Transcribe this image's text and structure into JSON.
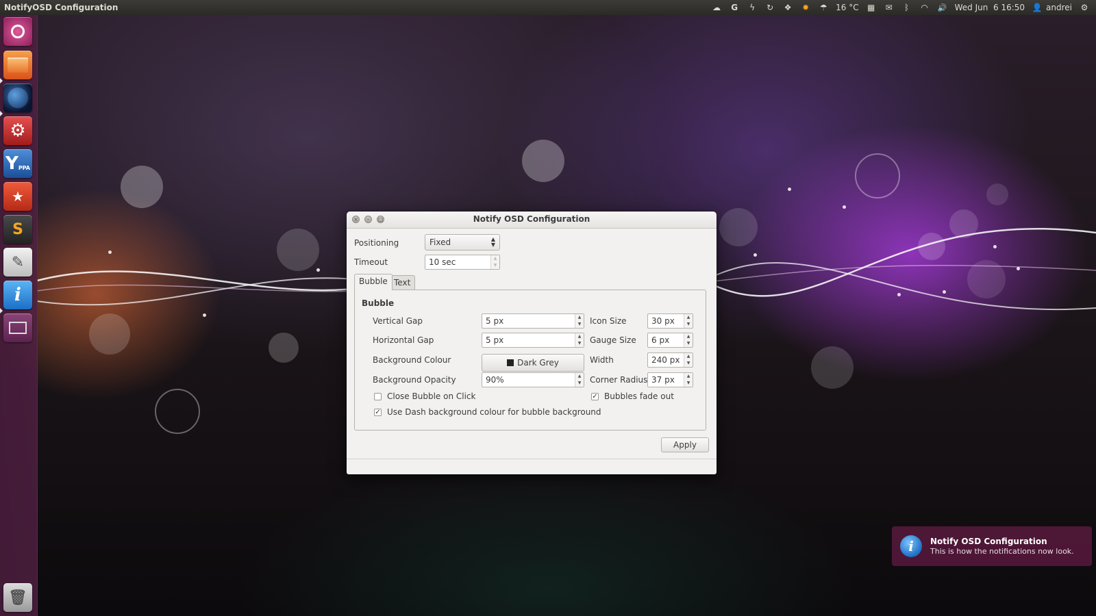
{
  "top_panel": {
    "app_title": "NotifyOSD Configuration",
    "indicators": [
      {
        "icon": "cloud-icon",
        "glyph": "☁"
      },
      {
        "icon": "g-icon",
        "glyph": "G"
      },
      {
        "icon": "lightning-icon",
        "glyph": "ϟ"
      },
      {
        "icon": "sync-icon",
        "glyph": "↻"
      },
      {
        "icon": "dropbox-icon",
        "glyph": "❖"
      },
      {
        "icon": "sun-icon",
        "glyph": "✹"
      }
    ],
    "weather_icon": "rain-cloud-icon",
    "weather_temp": "16 °C",
    "tray_icons": [
      {
        "icon": "calendar-icon",
        "glyph": "▦"
      },
      {
        "icon": "mail-icon",
        "glyph": "✉"
      },
      {
        "icon": "bluetooth-icon",
        "glyph": "ᛒ"
      },
      {
        "icon": "wifi-icon",
        "glyph": "◠"
      },
      {
        "icon": "volume-icon",
        "glyph": "🔊"
      }
    ],
    "clock": "Wed Jun  6 16:50",
    "user": "andrei"
  },
  "launcher": {
    "items": [
      {
        "icon": "dash-home-icon",
        "running": false
      },
      {
        "icon": "files-icon",
        "running": true
      },
      {
        "icon": "globe-icon",
        "running": true
      },
      {
        "icon": "system-settings-icon",
        "running": false
      },
      {
        "icon": "y-ppa-icon",
        "running": false,
        "label": "Y",
        "sub": "PPA"
      },
      {
        "icon": "software-center-icon",
        "running": false
      },
      {
        "icon": "sublime-text-icon",
        "running": false,
        "label": "S"
      },
      {
        "icon": "text-editor-icon",
        "running": false
      },
      {
        "icon": "notify-osd-config-icon",
        "running": true,
        "label": "i"
      },
      {
        "icon": "workspace-switcher-icon",
        "running": false
      },
      {
        "icon": "trash-icon",
        "running": false
      }
    ]
  },
  "dialog": {
    "title": "Notify OSD Configuration",
    "positioning_label": "Positioning",
    "positioning_value": "Fixed",
    "timeout_label": "Timeout",
    "timeout_value": "10 sec",
    "tabs": [
      "Bubble",
      "Text"
    ],
    "active_tab": "Bubble",
    "section_title": "Bubble",
    "fields": {
      "vertical_gap": {
        "label": "Vertical Gap",
        "value": "5 px"
      },
      "horizontal_gap": {
        "label": "Horizontal Gap",
        "value": "5 px"
      },
      "background_colour": {
        "label": "Background Colour",
        "value": "Dark Grey",
        "swatch": "#222222"
      },
      "background_opacity": {
        "label": "Background Opacity",
        "value": "90%"
      },
      "icon_size": {
        "label": "Icon Size",
        "value": "30 px"
      },
      "gauge_size": {
        "label": "Gauge Size",
        "value": "6 px"
      },
      "width": {
        "label": "Width",
        "value": "240 px"
      },
      "corner_radius": {
        "label": "Corner Radius",
        "value": "37 px"
      }
    },
    "checkboxes": {
      "close_on_click": {
        "label": "Close Bubble on Click",
        "checked": false
      },
      "fade_out": {
        "label": "Bubbles fade out",
        "checked": true
      },
      "dash_bg": {
        "label": "Use Dash background colour for bubble background",
        "checked": true
      }
    },
    "apply_label": "Apply"
  },
  "notification": {
    "title": "Notify OSD Configuration",
    "body": "This is how the notifications now look.",
    "icon": "info-icon"
  }
}
